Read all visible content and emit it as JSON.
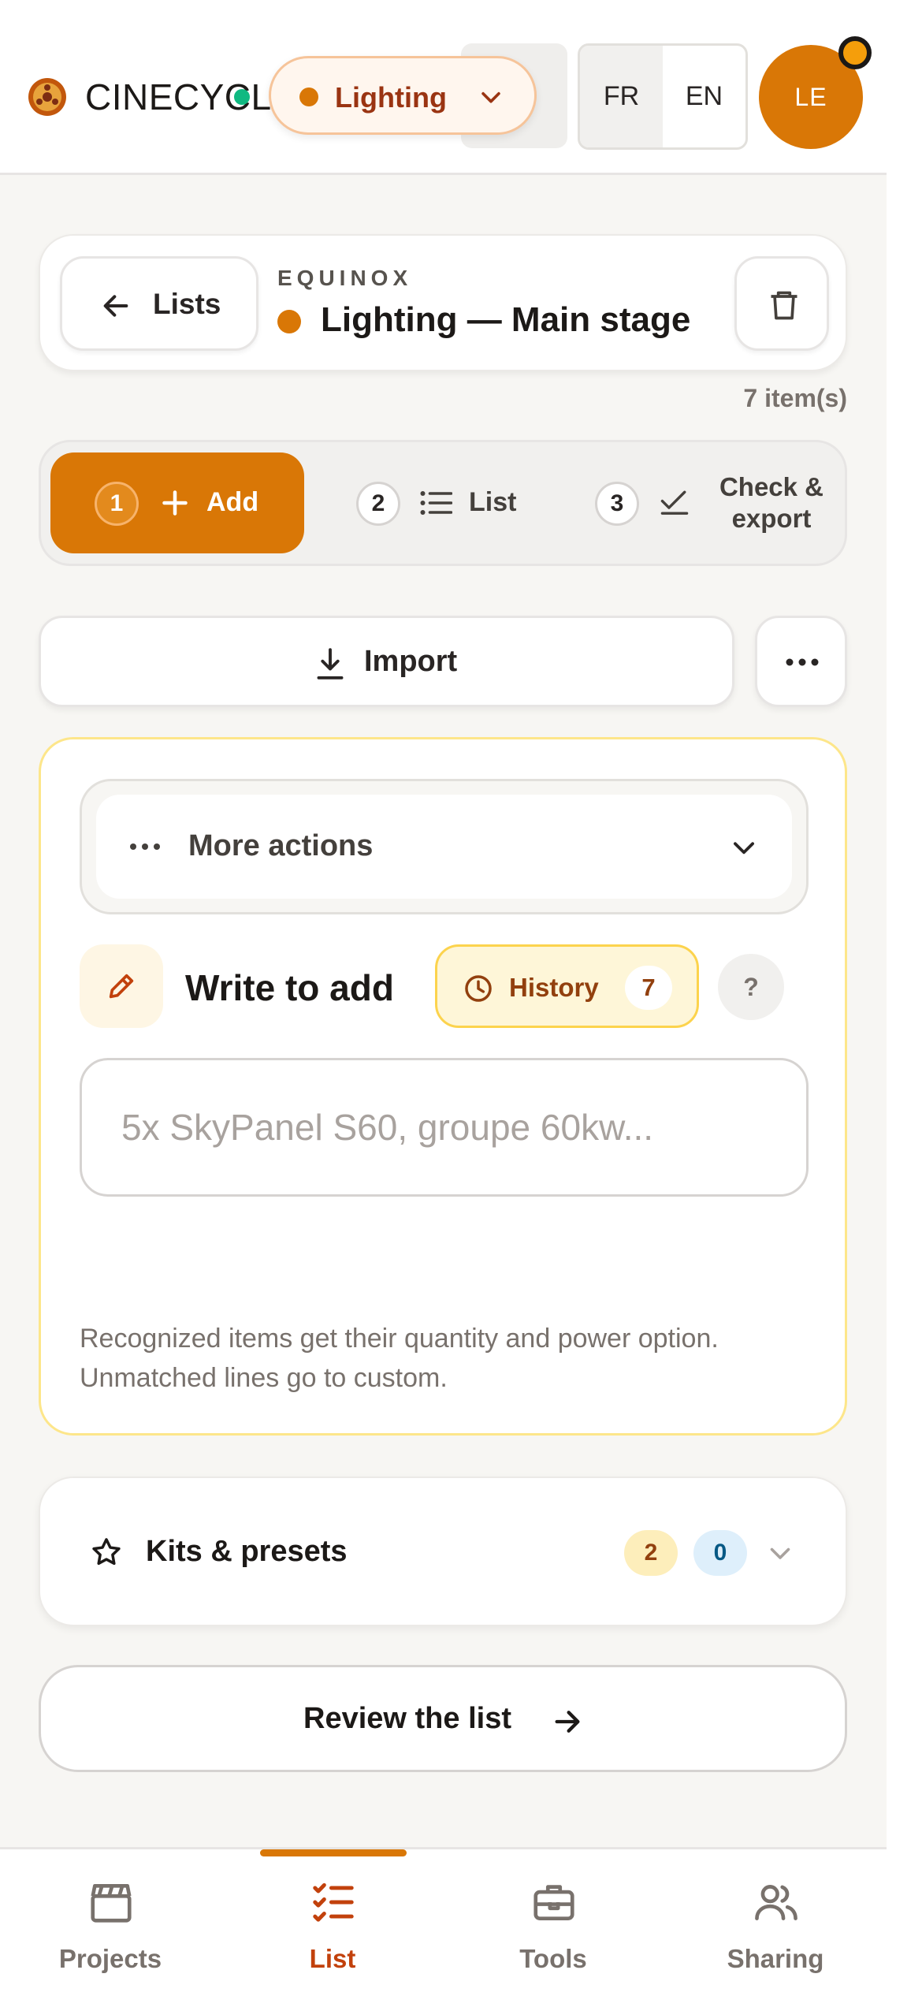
{
  "colors": {
    "accent": "#d97706",
    "status_online": "#10b981",
    "panel_border": "#fde68a",
    "text_dark": "#1c1917"
  },
  "header": {
    "brand": "CINECYCLO",
    "logo_icon": "film-reel-icon",
    "department": {
      "label": "Lighting",
      "icon": "chevron-down-icon"
    },
    "languages": [
      "FR",
      "EN"
    ],
    "selected_language": "FR",
    "avatar_initials": "LE"
  },
  "list_header": {
    "back_label": "Lists",
    "project_name": "EQUINOX",
    "list_title": "Lighting — Main stage",
    "item_count": "7 item(s)"
  },
  "stepper": {
    "steps": [
      {
        "number": "1",
        "label": "Add",
        "icon": "plus-icon",
        "active": true
      },
      {
        "number": "2",
        "label": "List",
        "icon": "list-icon",
        "active": false
      },
      {
        "number": "3",
        "label": "Check & export",
        "icon": "check-icon",
        "active": false
      }
    ]
  },
  "import": {
    "label": "Import",
    "icon": "download-icon"
  },
  "add_panel": {
    "more_actions_label": "More actions",
    "write_label": "Write to add",
    "history_label": "History",
    "history_count": "7",
    "help_label": "?",
    "input_placeholder": "5x SkyPanel S60, groupe 60kw...",
    "input_value": "",
    "hint": "Recognized items get their quantity and power option. Unmatched lines go to custom."
  },
  "kits": {
    "label": "Kits & presets",
    "count_primary": "2",
    "count_secondary": "0"
  },
  "review": {
    "label": "Review the list"
  },
  "bottom_nav": {
    "items": [
      {
        "label": "Projects",
        "icon": "clapperboard-icon",
        "active": false
      },
      {
        "label": "List",
        "icon": "checklist-icon",
        "active": true
      },
      {
        "label": "Tools",
        "icon": "toolbox-icon",
        "active": false
      },
      {
        "label": "Sharing",
        "icon": "users-icon",
        "active": false
      }
    ]
  }
}
